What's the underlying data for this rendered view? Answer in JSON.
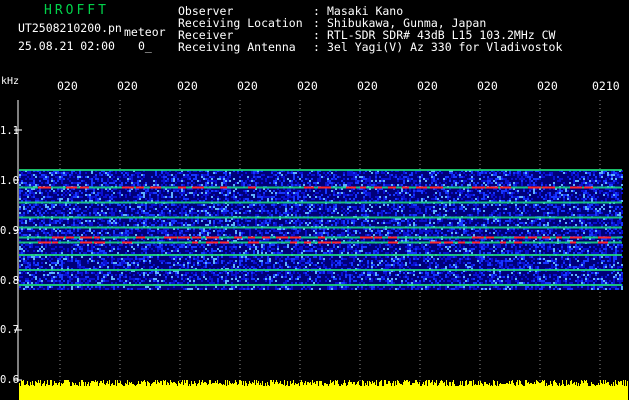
{
  "header": {
    "brand": "HROFFT",
    "filename": "UT2508210200.pn",
    "meteor_tag": "meteor",
    "datetime": "25.08.21 02:00",
    "extra": "0_"
  },
  "info": [
    {
      "label": "Observer",
      "value": "Masaki Kano"
    },
    {
      "label": "Receiving Location",
      "value": "Shibukawa, Gunma, Japan"
    },
    {
      "label": "Receiver",
      "value": "RTL-SDR SDR# 43dB L15 103.2MHz CW"
    },
    {
      "label": "Receiving Antenna",
      "value": "3el Yagi(V) Az 330 for Vladivostok"
    }
  ],
  "chart_data": {
    "type": "heatmap",
    "ylabel": "kHz",
    "x_tick_labels": [
      "020",
      "020",
      "020",
      "020",
      "020",
      "020",
      "020",
      "020",
      "020",
      "0210"
    ],
    "y_tick_labels": [
      "1.1",
      "1.0",
      "0.9",
      "0.8",
      "0.7",
      "0.6"
    ],
    "ylim": [
      0.6,
      1.1
    ],
    "signal_band_khz": [
      0.78,
      1.02
    ],
    "bright_lines_khz": [
      1.02,
      0.985,
      0.955,
      0.925,
      0.905,
      0.885,
      0.875,
      0.85,
      0.82,
      0.79
    ],
    "colors": {
      "background": "#000000",
      "noise_low": "#00007a",
      "noise_mid": "#1636ff",
      "line_green": "#1fe07a",
      "line_red": "#ff2a2a",
      "footer_bar": "#ffff00",
      "grid": "#8a8a8a"
    }
  }
}
